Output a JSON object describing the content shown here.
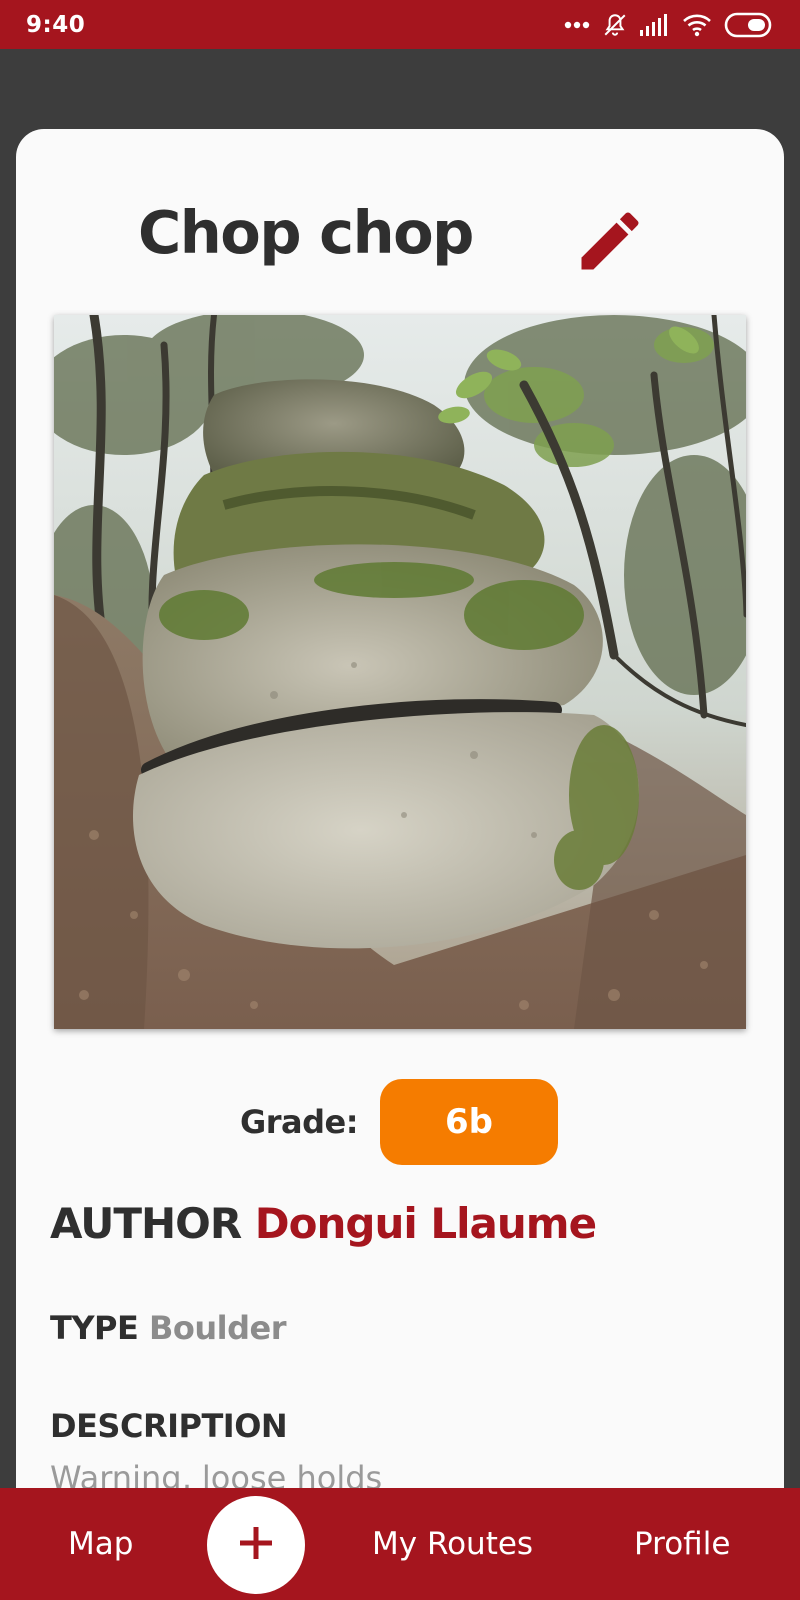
{
  "status_bar": {
    "time": "9:40",
    "icons": [
      "more-dots-icon",
      "bell-off-icon",
      "signal-icon",
      "wifi-icon",
      "battery-icon"
    ]
  },
  "route": {
    "title": "Chop chop",
    "edit_icon": "pencil-icon",
    "photo": "mossy-boulder-in-forest",
    "grade_label": "Grade:",
    "grade_value": "6b",
    "author_label": "AUTHOR",
    "author_name": "Dongui Llaume",
    "type_label": "TYPE",
    "type_value": "Boulder",
    "description_label": "DESCRIPTION",
    "description_text": "Warning, loose holds"
  },
  "bottom_nav": {
    "map_label": "Map",
    "add_icon": "plus-icon",
    "my_routes_label": "My Routes",
    "profile_label": "Profile"
  },
  "colors": {
    "brand": "#a5151e",
    "grade_badge": "#f57c00",
    "backdrop": "#3d3d3d"
  }
}
